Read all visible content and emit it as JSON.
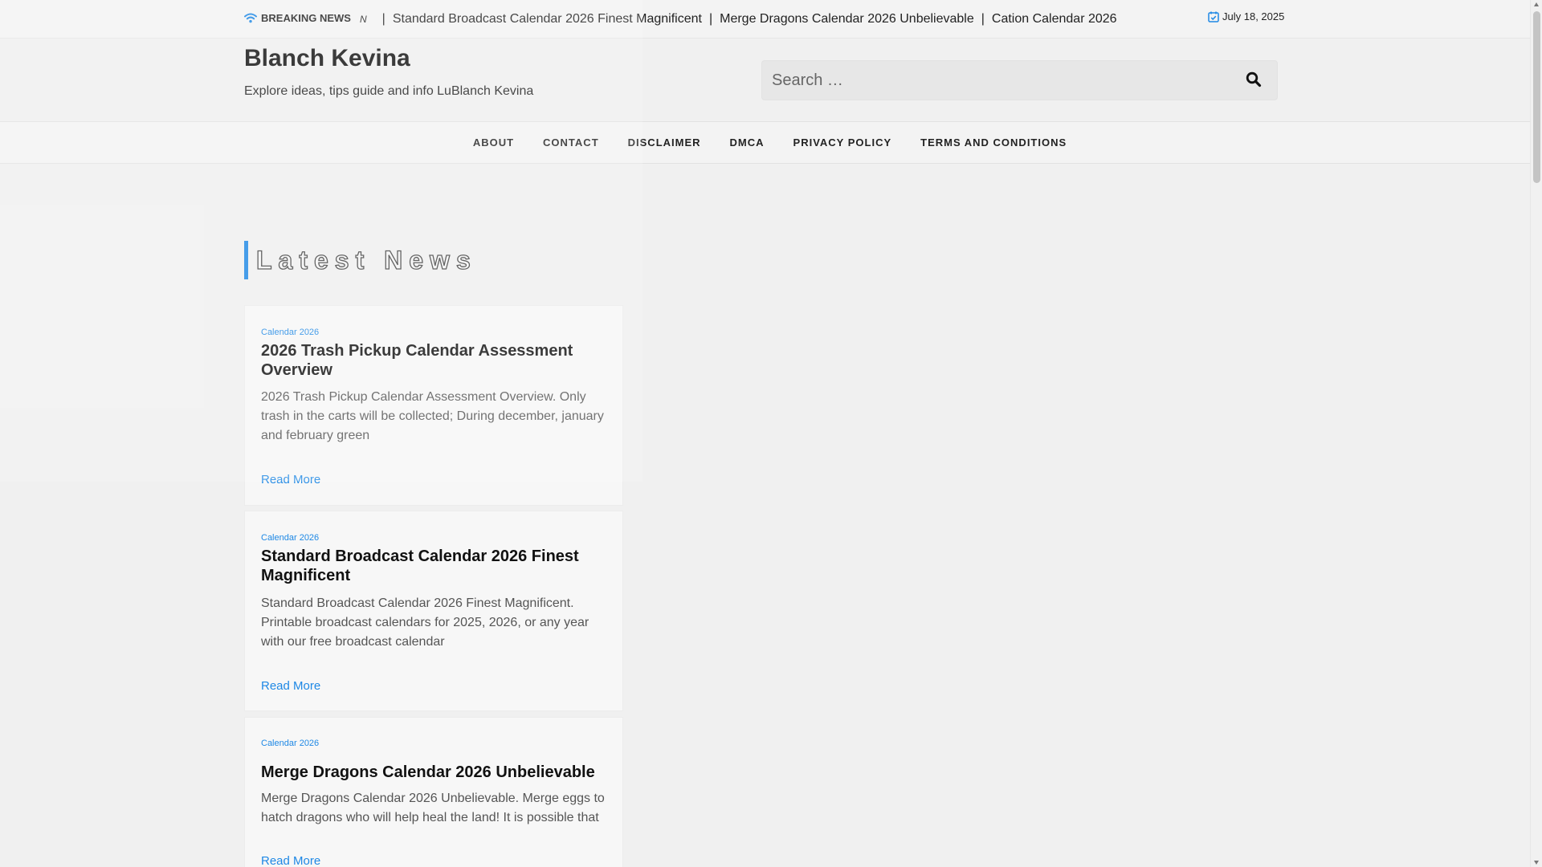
{
  "topbar": {
    "breaking_label": "BREAKING NEWS",
    "ticker_cut": "N",
    "ticker_items": [
      "Standard Broadcast Calendar 2026 Finest Magnificent",
      "Merge Dragons Calendar 2026 Unbelievable",
      "Cation Calendar 2026"
    ],
    "separator": "|",
    "date": "July 18, 2025"
  },
  "header": {
    "site_title": "Blanch Kevina",
    "tagline": "Explore ideas, tips guide and info LuBlanch Kevina",
    "search_placeholder": "Search …"
  },
  "nav": {
    "items": [
      "ABOUT",
      "CONTACT",
      "DISCLAIMER",
      "DMCA",
      "PRIVACY POLICY",
      "TERMS AND CONDITIONS"
    ]
  },
  "section": {
    "title": "Latest News"
  },
  "posts": [
    {
      "category": "Calendar 2026",
      "title": "2026 Trash Pickup Calendar Assessment Overview",
      "excerpt": "2026 Trash Pickup Calendar Assessment Overview. Only trash in the carts will be collected; During december, january and february green",
      "read_more": "Read More"
    },
    {
      "category": "Calendar 2026",
      "title": "Standard Broadcast Calendar 2026 Finest Magnificent",
      "excerpt": "Standard Broadcast Calendar 2026 Finest Magnificent. Printable broadcast calendars for 2025, 2026, or any year with our free broadcast calendar",
      "read_more": "Read More"
    },
    {
      "category": "Calendar 2026",
      "title": "Merge Dragons Calendar 2026 Unbelievable",
      "excerpt": "Merge Dragons Calendar 2026 Unbelievable. Merge eggs to hatch dragons who will help heal the land! It is possible that",
      "read_more": "Read More"
    }
  ],
  "colors": {
    "accent": "#1e88e5",
    "background": "#f0f0f0",
    "card": "#f7f7f7"
  },
  "icons": {
    "breaking": "wifi-icon",
    "date": "calendar-check-icon",
    "search": "search-icon"
  }
}
